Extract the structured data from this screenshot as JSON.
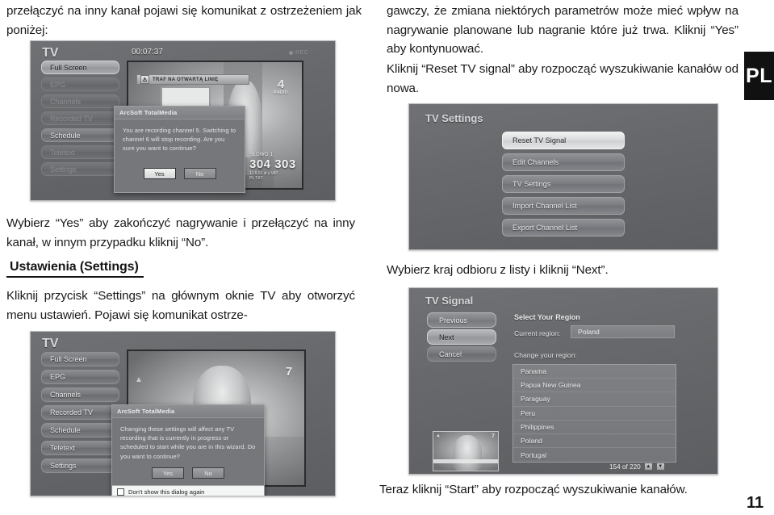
{
  "document": {
    "page_number": "11",
    "language_tab": "PL"
  },
  "text": {
    "left_top": "przełączyć na inny kanał pojawi się komunikat z ostrzeżeniem jak poniżej:",
    "right_top": "gawczy, że zmiana niektórych parametrów może mieć wpływ na nagrywanie planowane lub nagranie które już trwa. Kliknij “Yes” aby kontynuować.",
    "right_second": "Kliknij “Reset TV signal” aby rozpocząć wyszukiwanie kanałów od nowa.",
    "left_mid": "Wybierz “Yes” aby zakończyć nagrywanie i przełączyć na inny kanał, w innym przypadku kliknij “No”.",
    "section_heading": "Ustawienia (Settings)",
    "left_bottom": "Kliknij przycisk “Settings” na głównym oknie TV aby otworzyć menu ustawień. Pojawi się komunikat ostrze-",
    "right_region": "Wybierz kraj odbioru z listy i kliknij “Next”.",
    "right_bottom": "Teraz kliknij “Start” aby rozpocząć wyszukiwanie kanałów."
  },
  "screenshot_tv_recording": {
    "title": "TV",
    "time": "00:07:37",
    "rec_label": "REC",
    "menu": [
      {
        "label": "Full Screen",
        "state": "highlight"
      },
      {
        "label": "EPG",
        "state": "dim"
      },
      {
        "label": "Channels",
        "state": "dim"
      },
      {
        "label": "Recorded TV",
        "state": "dim"
      },
      {
        "label": "Schedule",
        "state": "normal"
      },
      {
        "label": "Teletext",
        "state": "dim"
      },
      {
        "label": "Settings",
        "state": "dim"
      }
    ],
    "ticker_text": "TRAF NA OTWARTĄ LINIĘ",
    "channel_logo": "4",
    "channel_logo_sub": "RADIO",
    "score_label": "SŁOWO 1",
    "score_number": "304 303",
    "score_sub": "1 i 9,51 zł z VAT",
    "score_sub2": "PL TXT",
    "dialog": {
      "title": "ArcSoft TotalMedia",
      "message": "You are recording channel 5. Switching to channel 6 will stop recording. Are you sure you want to continue?",
      "yes_label": "Yes",
      "no_label": "No"
    }
  },
  "screenshot_tv_settings": {
    "title": "TV Settings",
    "buttons": [
      {
        "label": "Reset TV Signal",
        "state": "highlight"
      },
      {
        "label": "Edit Channels",
        "state": "normal"
      },
      {
        "label": "TV Settings",
        "state": "normal"
      },
      {
        "label": "Import Channel List",
        "state": "normal"
      },
      {
        "label": "Export Channel List",
        "state": "normal"
      }
    ]
  },
  "screenshot_tv_wizard": {
    "title": "TV",
    "menu": [
      {
        "label": "Full Screen",
        "state": "normal"
      },
      {
        "label": "EPG",
        "state": "normal"
      },
      {
        "label": "Channels",
        "state": "normal"
      },
      {
        "label": "Recorded TV",
        "state": "normal"
      },
      {
        "label": "Schedule",
        "state": "normal"
      },
      {
        "label": "Teletext",
        "state": "normal"
      },
      {
        "label": "Settings",
        "state": "normal"
      }
    ],
    "channel_logo": "7",
    "dialog": {
      "title": "ArcSoft TotalMedia",
      "message": "Changing these settings will affect any TV recording that is currently in progress or scheduled to start while you are in this wizard. Do you want to continue?",
      "yes_label": "Yes",
      "no_label": "No",
      "checkbox_label": "Don't show this dialog again"
    }
  },
  "screenshot_tv_signal": {
    "title": "TV Signal",
    "nav_buttons": [
      {
        "label": "Previous",
        "state": "normal"
      },
      {
        "label": "Next",
        "state": "highlight"
      },
      {
        "label": "Cancel",
        "state": "normal"
      }
    ],
    "section_title": "Select Your Region",
    "current_region_label": "Current region:",
    "current_region_value": "Poland",
    "change_region_label": "Change your region:",
    "regions": [
      "Panama",
      "Papua New Guinea",
      "Paraguay",
      "Peru",
      "Philippines",
      "Poland",
      "Portugal"
    ],
    "counter": "154 of 220",
    "scroll_up_icon": "▲",
    "scroll_down_icon": "▼"
  }
}
